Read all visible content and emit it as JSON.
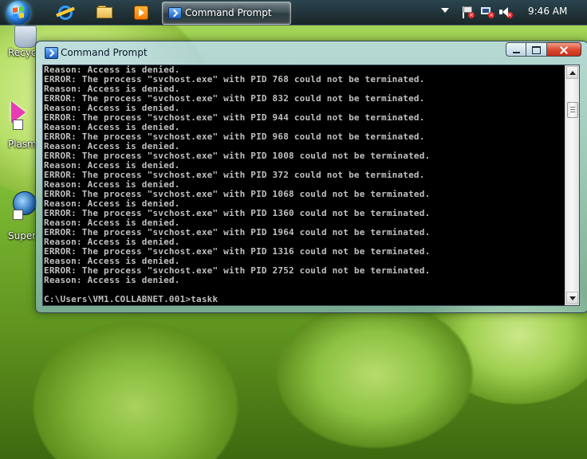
{
  "taskbar": {
    "task_button_title": "Command Prompt",
    "clock": "9:46 AM"
  },
  "desktop": {
    "icons": [
      {
        "label": "Recyc"
      },
      {
        "label": "Plasm"
      },
      {
        "label": "Super"
      }
    ]
  },
  "window": {
    "title": "Command Prompt",
    "console": {
      "lines": [
        "Reason: Access is denied.",
        "ERROR: The process \"svchost.exe\" with PID 768 could not be terminated.",
        "Reason: Access is denied.",
        "ERROR: The process \"svchost.exe\" with PID 832 could not be terminated.",
        "Reason: Access is denied.",
        "ERROR: The process \"svchost.exe\" with PID 944 could not be terminated.",
        "Reason: Access is denied.",
        "ERROR: The process \"svchost.exe\" with PID 968 could not be terminated.",
        "Reason: Access is denied.",
        "ERROR: The process \"svchost.exe\" with PID 1008 could not be terminated.",
        "Reason: Access is denied.",
        "ERROR: The process \"svchost.exe\" with PID 372 could not be terminated.",
        "Reason: Access is denied.",
        "ERROR: The process \"svchost.exe\" with PID 1068 could not be terminated.",
        "Reason: Access is denied.",
        "ERROR: The process \"svchost.exe\" with PID 1360 could not be terminated.",
        "Reason: Access is denied.",
        "ERROR: The process \"svchost.exe\" with PID 1964 could not be terminated.",
        "Reason: Access is denied.",
        "ERROR: The process \"svchost.exe\" with PID 1316 could not be terminated.",
        "Reason: Access is denied.",
        "ERROR: The process \"svchost.exe\" with PID 2752 could not be terminated.",
        "Reason: Access is denied.",
        "",
        "C:\\Users\\VM1.COLLABNET.001>taskk"
      ]
    }
  }
}
